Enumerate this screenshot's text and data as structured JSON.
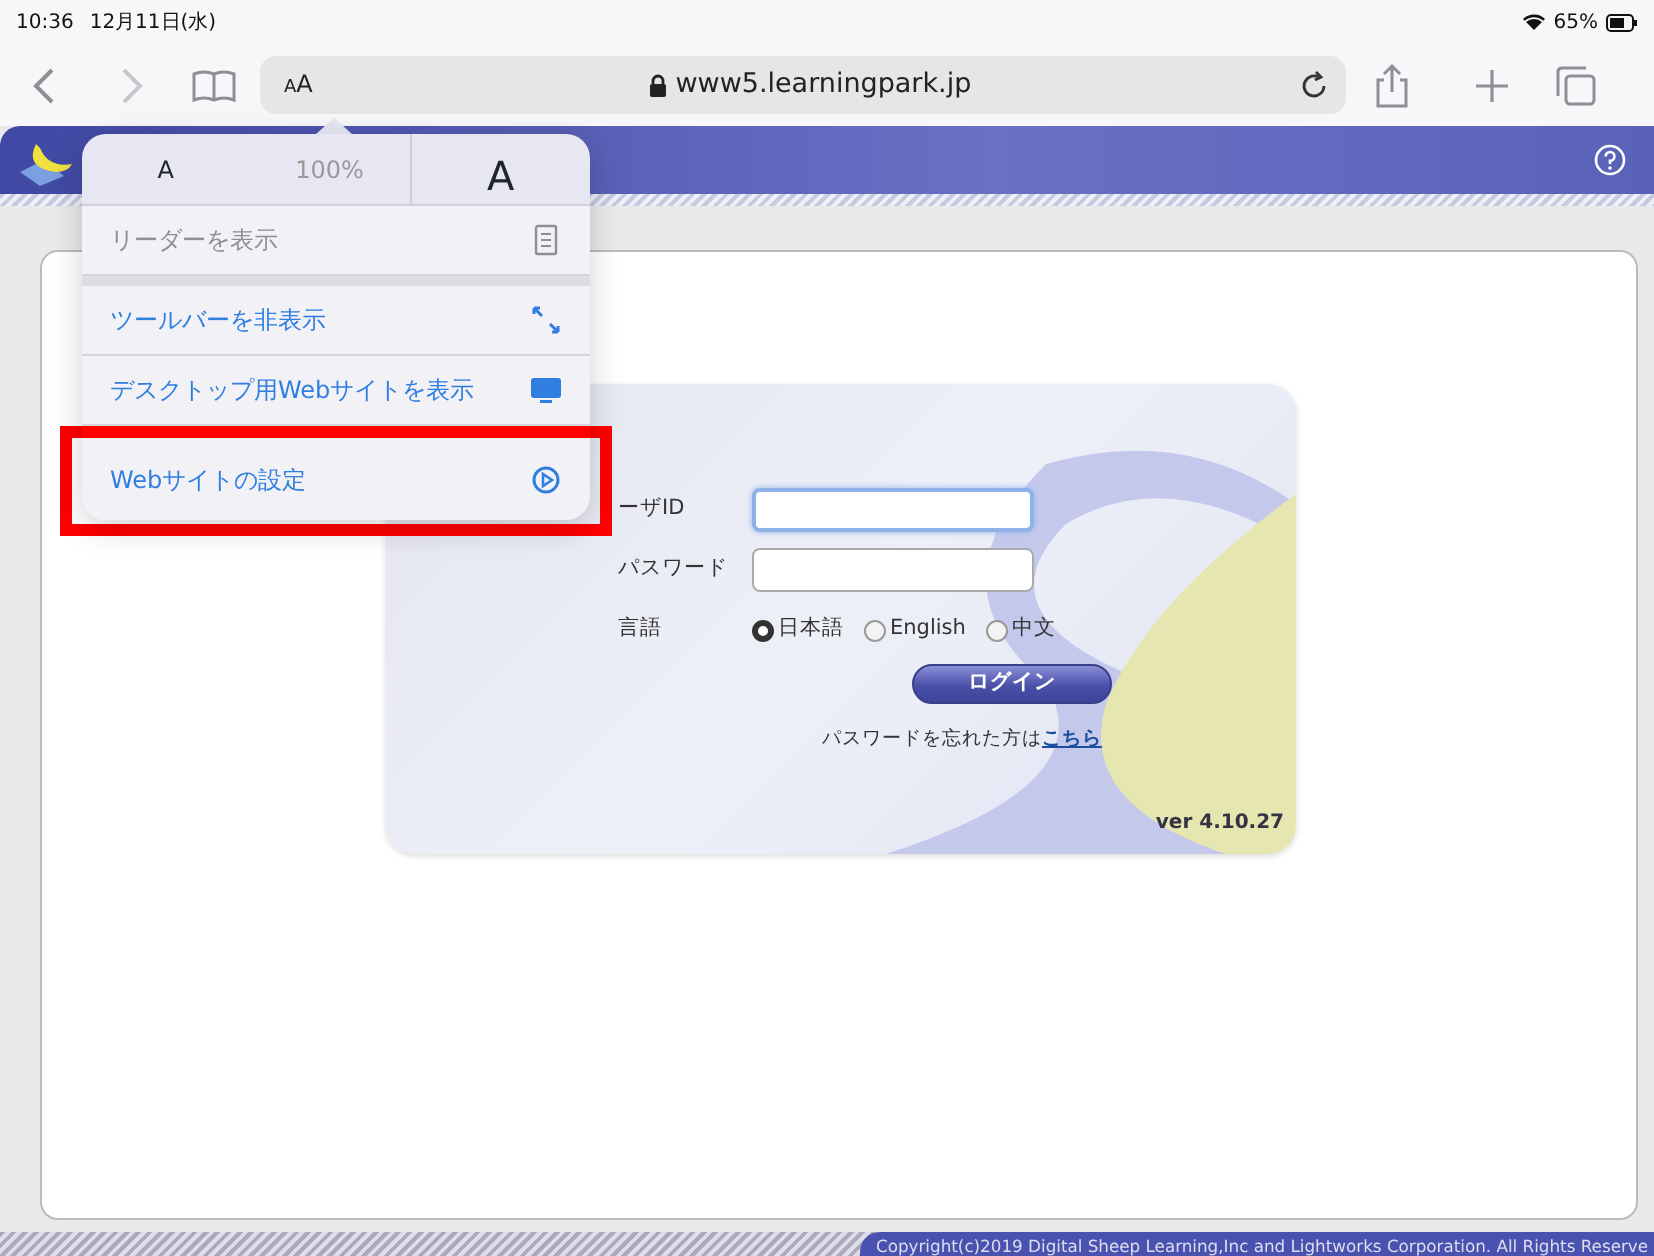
{
  "status_bar": {
    "time": "10:36",
    "date": "12月11日(水)",
    "battery": "65%"
  },
  "toolbar": {
    "text_size_button": "AA",
    "url": "www5.learningpark.jp"
  },
  "popover": {
    "font_small": "A",
    "zoom": "100%",
    "font_large": "A",
    "items": [
      {
        "label": "リーダーを表示",
        "kind": "reader",
        "disabled": true,
        "highlighted": false
      },
      {
        "label": "ツールバーを非表示",
        "kind": "expand",
        "disabled": false,
        "highlighted": false
      },
      {
        "label": "デスクトップ用Webサイトを表示",
        "kind": "desktop",
        "disabled": false,
        "highlighted": false
      },
      {
        "label": "Webサイトの設定",
        "kind": "settings",
        "disabled": false,
        "highlighted": true
      }
    ]
  },
  "login": {
    "fields": [
      {
        "label": "ーザID",
        "focused": true
      },
      {
        "label": "パスワード",
        "focused": false
      }
    ],
    "language_label": "言語",
    "languages": [
      {
        "label": "日本語",
        "selected": true
      },
      {
        "label": "English",
        "selected": false
      },
      {
        "label": "中文",
        "selected": false
      }
    ],
    "button": "ログイン",
    "forgot_text": "パスワードを忘れた方は",
    "forgot_link": "こちら",
    "version": "ver 4.10.27"
  },
  "footer": {
    "copyright": "Copyright(c)2019 Digital Sheep Learning,Inc and Lightworks Corporation. All Rights Reserve"
  }
}
